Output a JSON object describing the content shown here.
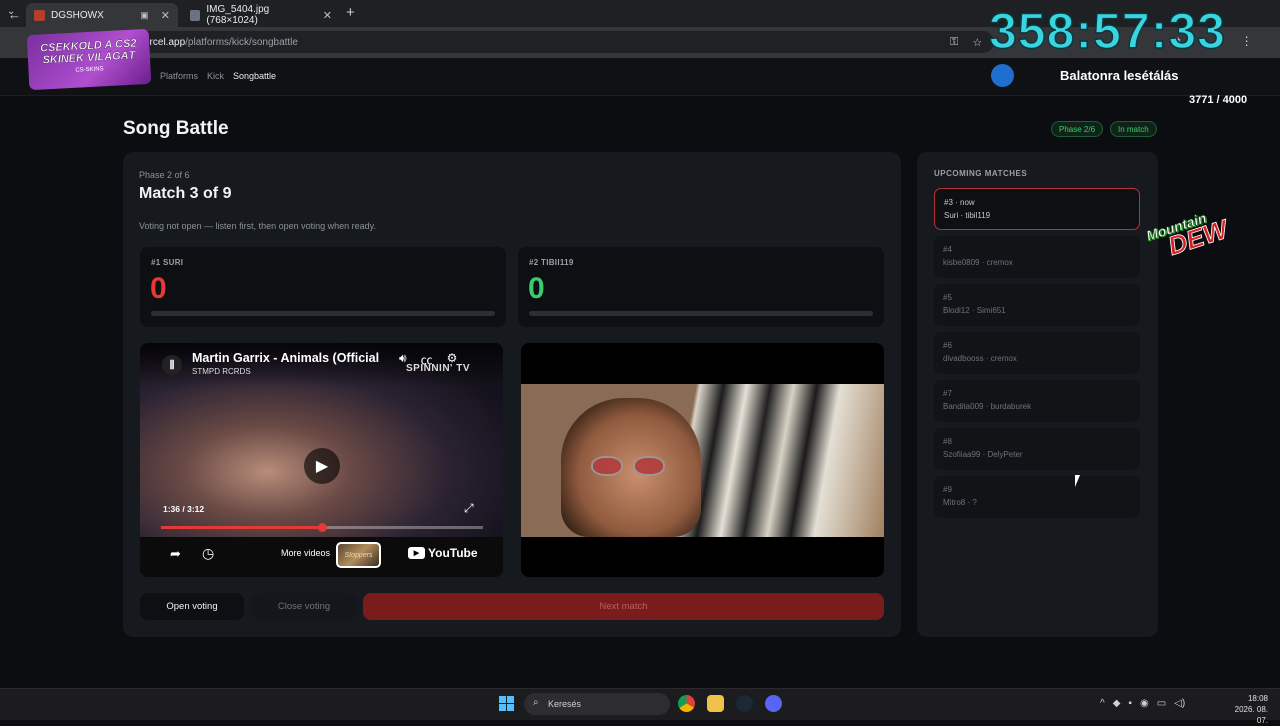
{
  "browser": {
    "tabs": [
      {
        "title": "DGSHOWX",
        "active": true
      },
      {
        "title": "IMG_5404.jpg (768×1024)",
        "active": false
      }
    ],
    "url_host": "ercel.app",
    "url_path": "/platforms/kick/songbattle"
  },
  "breadcrumbs": [
    "Platforms",
    "Kick",
    "Songbattle"
  ],
  "page": {
    "title": "Song Battle",
    "phase_badge": "Phase 2/6",
    "state_badge": "In match"
  },
  "match": {
    "phase_label": "Phase 2 of 6",
    "title": "Match 3 of 9",
    "voting_note": "Voting not open — listen first, then open voting when ready.",
    "left": {
      "name": "#1 SURI",
      "score": "0",
      "vote_share": 0
    },
    "right": {
      "name": "#2 TIBII119",
      "score": "0",
      "vote_share": 0
    }
  },
  "video_left": {
    "title": "Martin Garrix - Animals (Official",
    "channel": "STMPD RCRDS",
    "watermark": "SPINNIN' TV",
    "time": "1:36 / 3:12",
    "progress": 0.5,
    "more_videos": "More videos",
    "youtube_label": "YouTube",
    "thumb_text": "Stoppers"
  },
  "buttons": {
    "open_voting": "Open voting",
    "close_voting": "Close voting",
    "next_match": "Next match"
  },
  "upcoming": {
    "title": "UPCOMING MATCHES",
    "items": [
      {
        "num": "#3 · now",
        "players": "Suri · tibil119",
        "current": true
      },
      {
        "num": "#4",
        "players": "kisbe0809 · cremox"
      },
      {
        "num": "#5",
        "players": "Blodi12 · Simi651"
      },
      {
        "num": "#6",
        "players": "divadbooss · cremox"
      },
      {
        "num": "#7",
        "players": "Bandita009 · burdaburek"
      },
      {
        "num": "#8",
        "players": "Szofiiaa99 · DelyPeter"
      },
      {
        "num": "#9",
        "players": "Mitro8 · ?"
      }
    ]
  },
  "overlay": {
    "timer": "358:57:33",
    "goal_text": "Balatonra lesétálás",
    "goal_count": "3771 / 4000",
    "promo_line1": "CSEKKOLD A CS2",
    "promo_line2": "SKINEK VILÁGÁT",
    "promo_brand": "CS-SKINS",
    "sponsor_line1": "Mountain",
    "sponsor_line2": "DEW"
  },
  "taskbar": {
    "search_placeholder": "Keresés",
    "time": "18:08",
    "date": "2026. 08. 07."
  },
  "colors": {
    "accent_red": "#e53935",
    "accent_green": "#3ccb6c",
    "timer_cyan": "#3ad4e0"
  }
}
